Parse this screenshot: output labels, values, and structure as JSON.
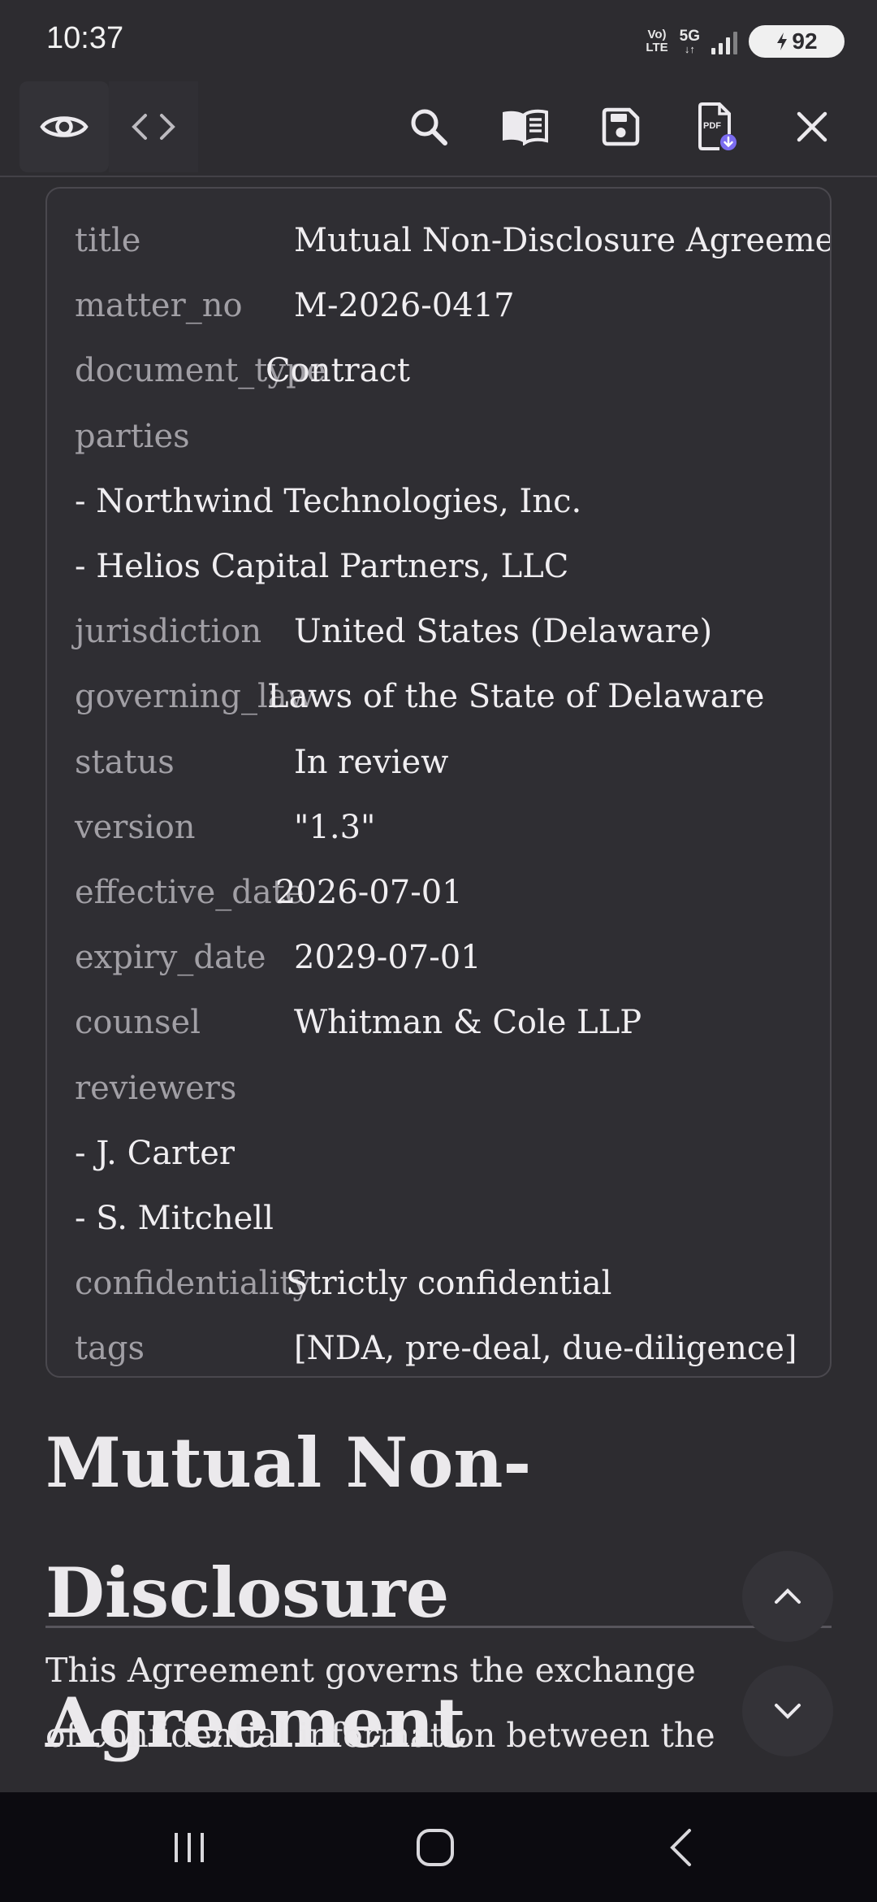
{
  "status_bar": {
    "time": "10:37",
    "volte": [
      "Vo)",
      "LTE"
    ],
    "network": "5G",
    "battery": "92"
  },
  "toolbar": {
    "left": [
      {
        "icon": "eye-icon",
        "label": "Preview"
      },
      {
        "icon": "code-icon",
        "label": "Source"
      }
    ],
    "right": [
      {
        "icon": "search-icon"
      },
      {
        "icon": "book-icon"
      },
      {
        "icon": "save-icon"
      },
      {
        "icon": "pdf-export-icon",
        "badge_text": "PDF",
        "accent": "#7b6cf0"
      },
      {
        "icon": "close-icon"
      }
    ]
  },
  "front_matter": [
    {
      "key": "title",
      "value": "Mutual Non-Disclosure Agreeme"
    },
    {
      "key": "matter_no",
      "value": "M-2026-0417"
    },
    {
      "key": "document_type",
      "value": "Contract"
    },
    {
      "key": "parties",
      "value": ""
    },
    {
      "key": "",
      "value": "- Northwind Technologies, Inc."
    },
    {
      "key": "",
      "value": "- Helios Capital Partners, LLC"
    },
    {
      "key": "jurisdiction",
      "value": "United States (Delaware)"
    },
    {
      "key": "governing_law",
      "value": "Laws of the State of Delaware"
    },
    {
      "key": "status",
      "value": "In review"
    },
    {
      "key": "version",
      "value": "\"1.3\""
    },
    {
      "key": "effective_date",
      "value": "2026-07-01"
    },
    {
      "key": "expiry_date",
      "value": "2029-07-01"
    },
    {
      "key": "counsel",
      "value": "Whitman & Cole LLP"
    },
    {
      "key": "reviewers",
      "value": ""
    },
    {
      "key": "",
      "value": "- J. Carter"
    },
    {
      "key": "",
      "value": "- S. Mitchell"
    },
    {
      "key": "confidentiality",
      "value": "Strictly confidential"
    },
    {
      "key": "tags",
      "value": "[NDA, pre-deal, due-diligence]"
    }
  ],
  "document": {
    "heading": "Mutual Non-Disclosure Agreement",
    "paragraph": "This Agreement governs the exchange of confidential information between the"
  },
  "fabs": {
    "up_icon": "chevron-up-icon",
    "down_icon": "chevron-down-icon"
  },
  "nav": {
    "recents_icon": "recents-icon",
    "home_icon": "home-icon",
    "back_icon": "back-icon"
  },
  "colors": {
    "background": "#2d2c30",
    "nav_background": "#0c0b10",
    "key_text": "#a19fa5"
  }
}
